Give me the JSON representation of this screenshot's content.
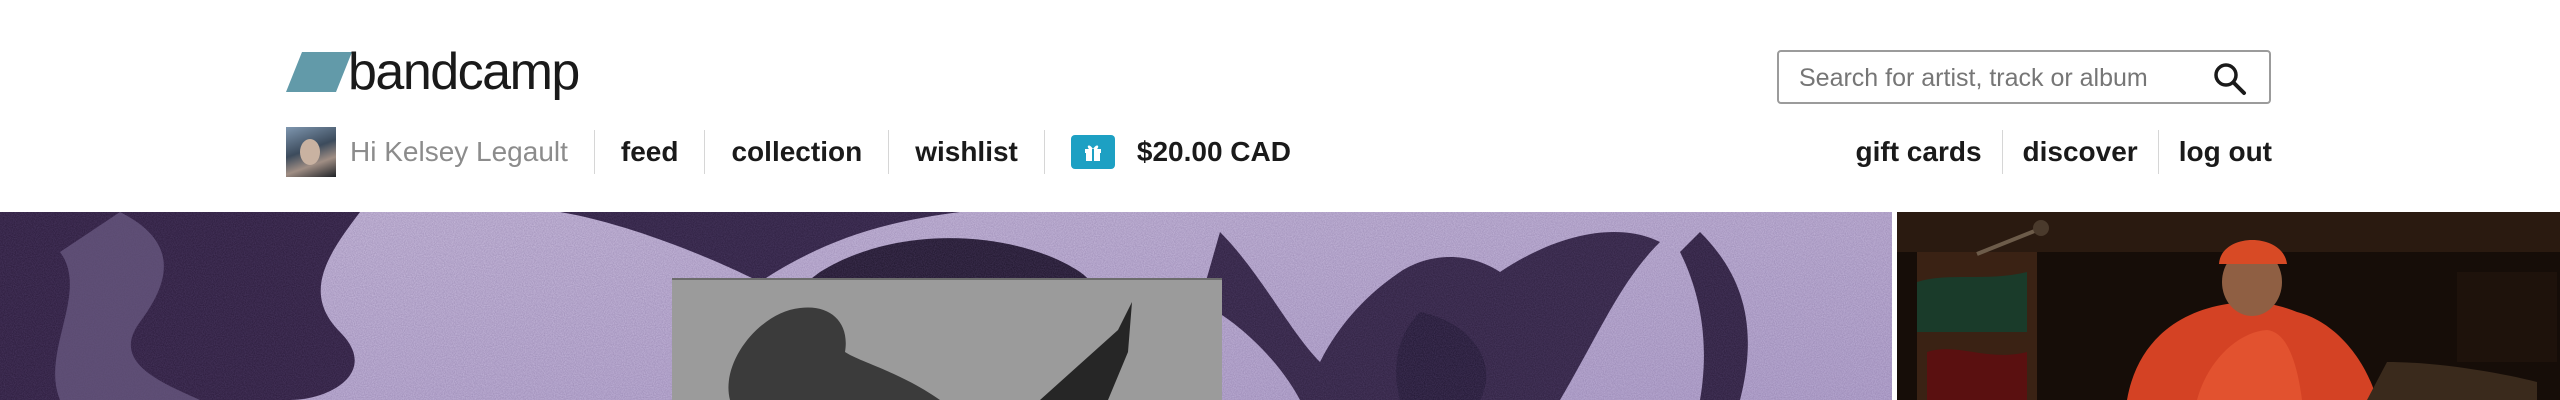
{
  "brand": {
    "name": "bandcamp",
    "color": "#629aa9"
  },
  "search": {
    "placeholder": "Search for artist, track or album"
  },
  "user": {
    "greeting": "Hi Kelsey Legault"
  },
  "nav": {
    "feed": "feed",
    "collection": "collection",
    "wishlist": "wishlist",
    "balance": "$20.00 CAD",
    "gift_cards": "gift cards",
    "discover": "discover",
    "log_out": "log out"
  },
  "colors": {
    "accent": "#1da0c3",
    "text": "#1a1a1a",
    "muted": "#8c8c8c"
  },
  "icons": [
    "search-icon",
    "gift-icon",
    "logo-mark"
  ]
}
